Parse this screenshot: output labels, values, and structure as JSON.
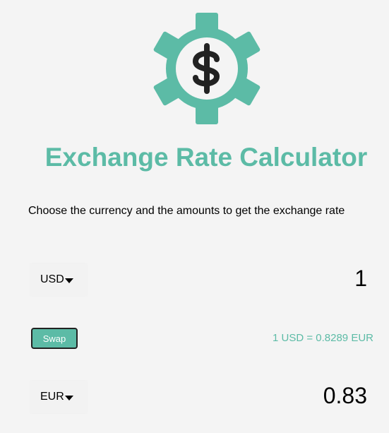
{
  "header": {
    "logo_icon": "gear-dollar-icon",
    "title": "Exchange Rate Calculator",
    "subtitle": "Choose the currency and the amounts to get the exchange rate"
  },
  "currency_one": {
    "code": "USD",
    "amount": "1"
  },
  "currency_two": {
    "code": "EUR",
    "amount": "0.83"
  },
  "swap": {
    "label": "Swap"
  },
  "rate": {
    "text": "1 USD = 0.8289 EUR"
  },
  "colors": {
    "accent": "#5cbba6",
    "background": "#f4f4f4",
    "text": "#000000"
  }
}
